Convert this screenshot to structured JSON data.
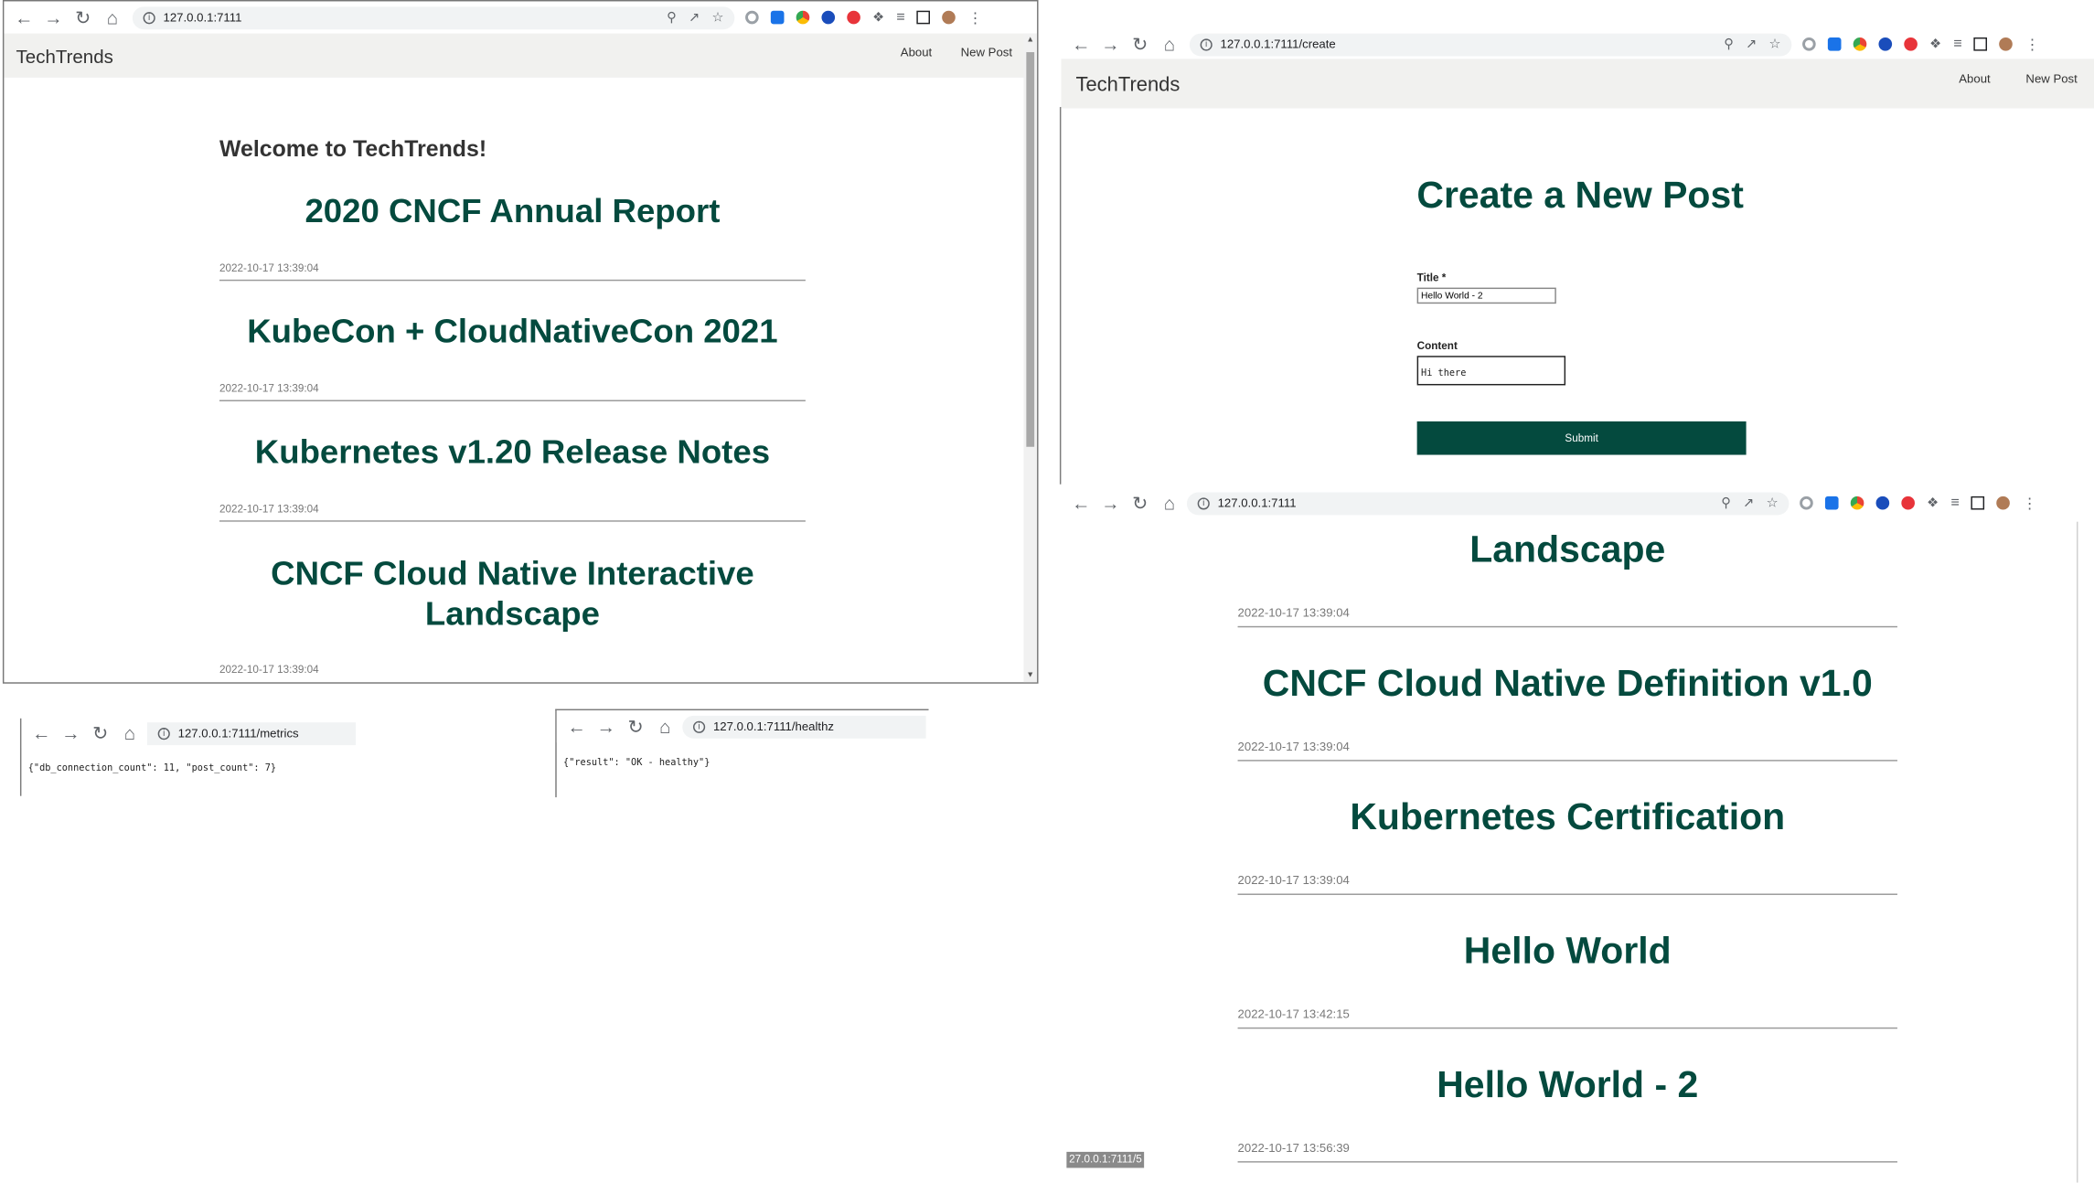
{
  "browser_icons": [
    "back-icon",
    "forward-icon",
    "reload-icon",
    "home-icon",
    "info-icon",
    "zoom-icon",
    "share-icon",
    "star-icon",
    "extension-icon",
    "puzzle-icon",
    "reading-list-icon",
    "sidebar-icon",
    "profile-avatar",
    "menu-icon"
  ],
  "app": {
    "brand": "TechTrends",
    "nav": {
      "about": "About",
      "new_post": "New Post"
    }
  },
  "window_index": {
    "url": "127.0.0.1:7111",
    "welcome": "Welcome to TechTrends!",
    "posts": [
      {
        "title": "2020 CNCF Annual Report",
        "date": "2022-10-17 13:39:04"
      },
      {
        "title": "KubeCon + CloudNativeCon 2021",
        "date": "2022-10-17 13:39:04"
      },
      {
        "title": "Kubernetes v1.20 Release Notes",
        "date": "2022-10-17 13:39:04"
      },
      {
        "title": "CNCF Cloud Native Interactive Landscape",
        "date": "2022-10-17 13:39:04"
      }
    ]
  },
  "window_create": {
    "url": "127.0.0.1:7111/create",
    "heading": "Create a New Post",
    "title_label": "Title *",
    "title_value": "Hello World - 2",
    "content_label": "Content",
    "content_value": "Hi there",
    "submit_label": "Submit"
  },
  "window_index_scrolled": {
    "url": "127.0.0.1:7111",
    "top_title_fragment": "Landscape",
    "posts": [
      {
        "title": "",
        "date": "2022-10-17 13:39:04"
      },
      {
        "title": "CNCF Cloud Native Definition v1.0",
        "date": "2022-10-17 13:39:04"
      },
      {
        "title": "Kubernetes Certification",
        "date": "2022-10-17 13:39:04"
      },
      {
        "title": "Hello World",
        "date": "2022-10-17 13:42:15"
      },
      {
        "title": "Hello World - 2",
        "date": "2022-10-17 13:56:39"
      }
    ],
    "status_url": "27.0.0.1:7111/5"
  },
  "window_metrics": {
    "url": "127.0.0.1:7111/metrics",
    "body": "{\"db_connection_count\": 11, \"post_count\": 7}"
  },
  "window_healthz": {
    "url": "127.0.0.1:7111/healthz",
    "body": "{\"result\": \"OK - healthy\"}"
  }
}
